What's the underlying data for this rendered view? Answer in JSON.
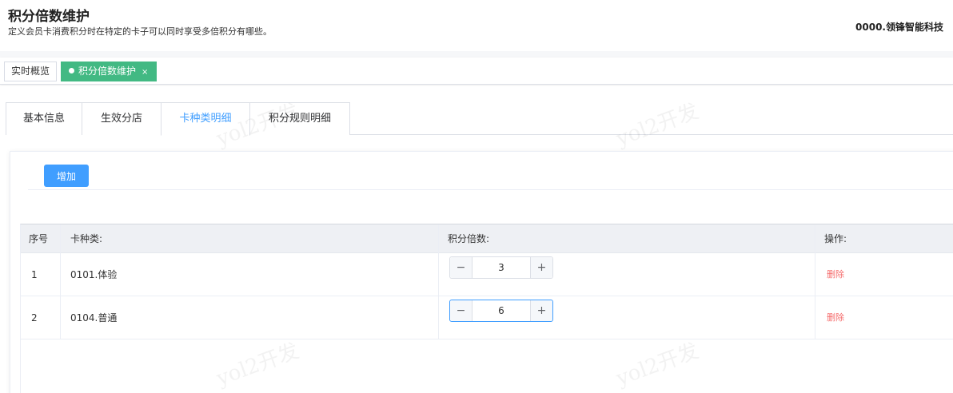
{
  "header": {
    "title": "积分倍数维护",
    "description": "定义会员卡消费积分时在特定的卡子可以同时享受多倍积分有哪些。",
    "company": "0000.领锋智能科技"
  },
  "tagbar": {
    "home_label": "实时概览",
    "active_label": "积分倍数维护",
    "close_glyph": "×"
  },
  "tabs": [
    {
      "label": "基本信息"
    },
    {
      "label": "生效分店"
    },
    {
      "label": "卡种类明细"
    },
    {
      "label": "积分规则明细"
    }
  ],
  "active_tab_index": 2,
  "toolbar": {
    "add_label": "增加"
  },
  "table": {
    "columns": [
      "序号",
      "卡种类:",
      "积分倍数:",
      "操作:"
    ],
    "rows": [
      {
        "index": "1",
        "card_type": "0101.体验",
        "multiple": "3",
        "action": "删除"
      },
      {
        "index": "2",
        "card_type": "0104.普通",
        "multiple": "6",
        "action": "删除"
      }
    ],
    "stepper_minus": "−",
    "stepper_plus": "+"
  },
  "watermark_text": "yol2开发",
  "colors": {
    "primary": "#409eff",
    "active_tag": "#42b983",
    "danger": "#f56c6c"
  }
}
